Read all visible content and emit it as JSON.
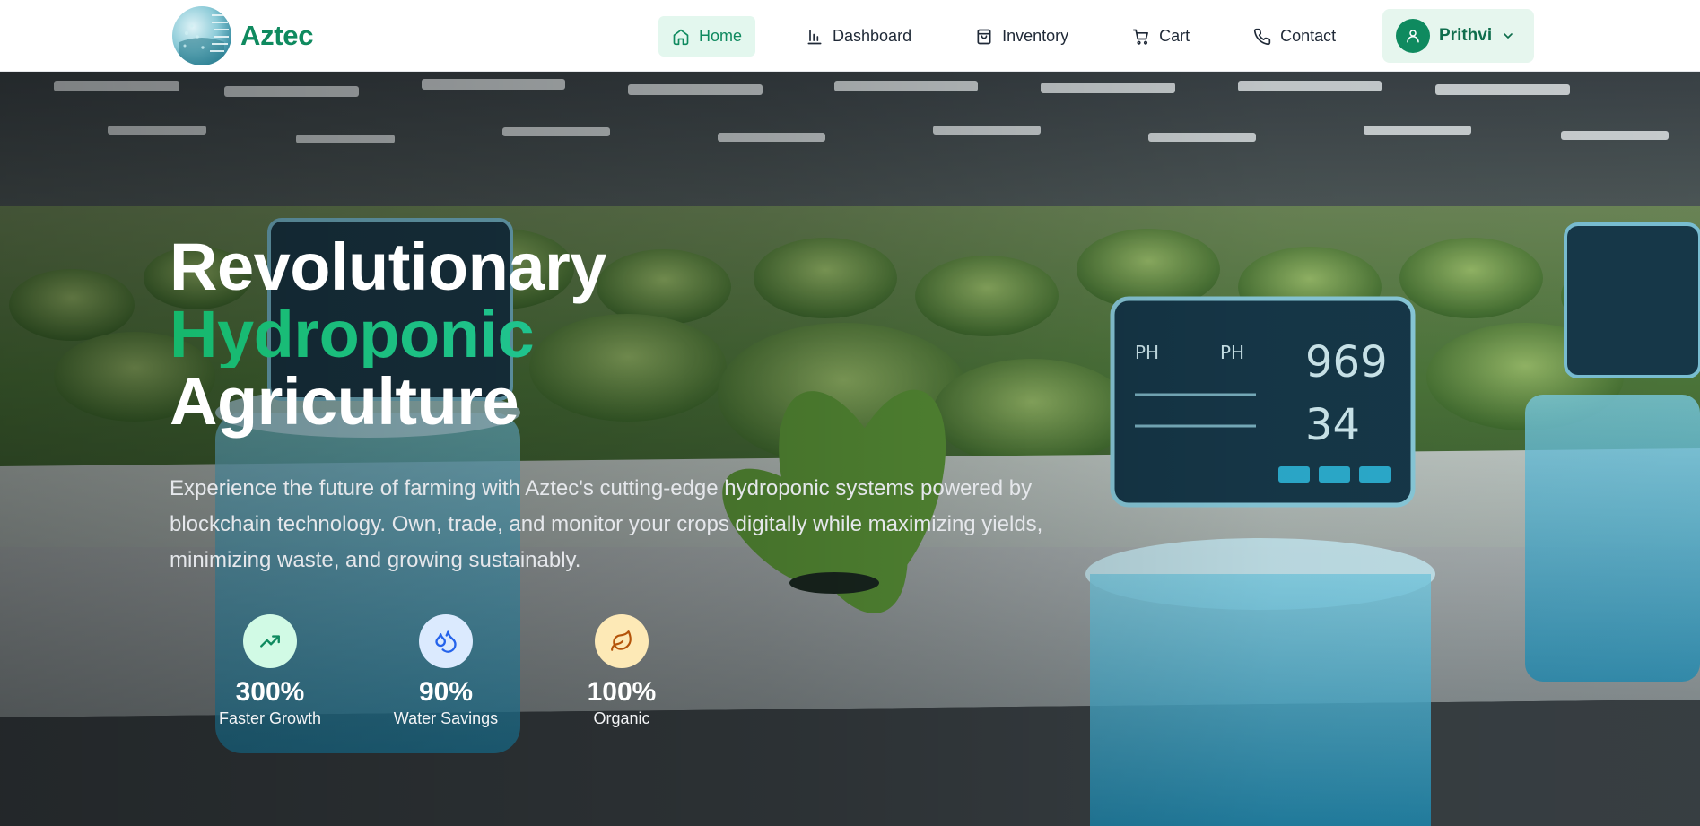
{
  "brand": {
    "name": "Aztec"
  },
  "nav": {
    "items": [
      {
        "label": "Home",
        "icon": "home-icon",
        "active": true
      },
      {
        "label": "Dashboard",
        "icon": "bar-chart-icon",
        "active": false
      },
      {
        "label": "Inventory",
        "icon": "shopping-bag-icon",
        "active": false
      },
      {
        "label": "Cart",
        "icon": "shopping-cart-icon",
        "active": false
      },
      {
        "label": "Contact",
        "icon": "phone-icon",
        "active": false
      }
    ]
  },
  "user": {
    "name": "Prithvi",
    "icon": "user-icon"
  },
  "hero": {
    "headline_line1": "Revolutionary",
    "headline_line2": "Hydroponic",
    "headline_line3": "Agriculture",
    "description": "Experience the future of farming with Aztec's cutting-edge hydroponic systems powered by blockchain technology. Own, trade, and monitor your crops digitally while maximizing yields, minimizing waste, and growing sustainably.",
    "stats": [
      {
        "value": "300%",
        "label": "Faster Growth",
        "icon": "trending-up-icon",
        "color": "#d1fae5"
      },
      {
        "value": "90%",
        "label": "Water Savings",
        "icon": "droplets-icon",
        "color": "#dbeafe"
      },
      {
        "value": "100%",
        "label": "Organic",
        "icon": "leaf-icon",
        "color": "#fde9b6"
      }
    ]
  },
  "colors": {
    "brand": "#0f8a5f",
    "accent_from": "#16b86c",
    "accent_to": "#2dd4bf"
  }
}
